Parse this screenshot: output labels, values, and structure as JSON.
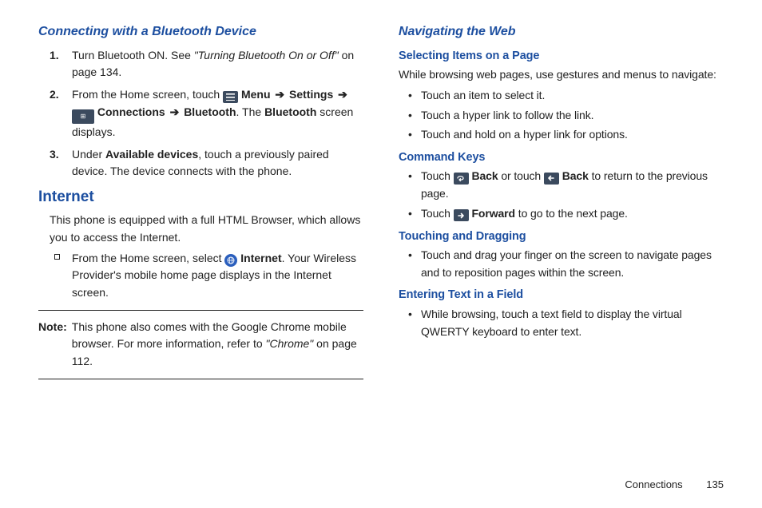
{
  "left": {
    "heading_bt": "Connecting with a Bluetooth Device",
    "steps": [
      {
        "num": "1.",
        "pre": "Turn Bluetooth ON. See ",
        "ref": "\"Turning Bluetooth On or Off\"",
        "post": " on page 134."
      },
      {
        "num": "2.",
        "pre": "From the Home screen, touch ",
        "menu": "Menu",
        "arrow1": "➔",
        "settings": "Settings",
        "arrow2": "➔",
        "connections": "Connections",
        "arrow3": "➔",
        "bluetooth": "Bluetooth",
        "post1": ". The ",
        "bluetooth2": "Bluetooth",
        "post2": " screen displays."
      },
      {
        "num": "3.",
        "pre": "Under ",
        "avail": "Available devices",
        "post": ", touch a previously paired device. The device connects with the phone."
      }
    ],
    "heading_internet": "Internet",
    "internet_intro": "This phone is equipped with a full HTML Browser, which allows you to access the Internet.",
    "internet_step_pre": "From the Home screen, select ",
    "internet_label": "Internet",
    "internet_step_post": ". Your Wireless Provider's mobile home page displays in the Internet screen.",
    "note_label": "Note:",
    "note_body_pre": "This phone also comes with the Google Chrome mobile browser. For more information, refer to ",
    "note_ref": "\"Chrome\"",
    "note_body_post": " on page 112."
  },
  "right": {
    "heading_nav": "Navigating the Web",
    "sub_select": "Selecting Items on a Page",
    "select_intro": "While browsing web pages, use gestures and menus to navigate:",
    "select_bullets": [
      "Touch an item to select it.",
      "Touch a hyper link to follow the link.",
      "Touch and hold on a hyper link for options."
    ],
    "sub_cmd": "Command Keys",
    "cmd1_pre": "Touch ",
    "cmd1_back": "Back",
    "cmd1_mid": " or touch ",
    "cmd1_back2": "Back",
    "cmd1_post": " to return to the previous page.",
    "cmd2_pre": "Touch ",
    "cmd2_fwd": "Forward",
    "cmd2_post": " to go to the next page.",
    "sub_touch": "Touching and Dragging",
    "touch_bullet": "Touch and drag your finger on the screen to navigate pages and to reposition pages within the screen.",
    "sub_enter": "Entering Text in a Field",
    "enter_bullet": "While browsing, touch a text field to display the virtual QWERTY keyboard to enter text."
  },
  "footer": {
    "section": "Connections",
    "page": "135"
  }
}
